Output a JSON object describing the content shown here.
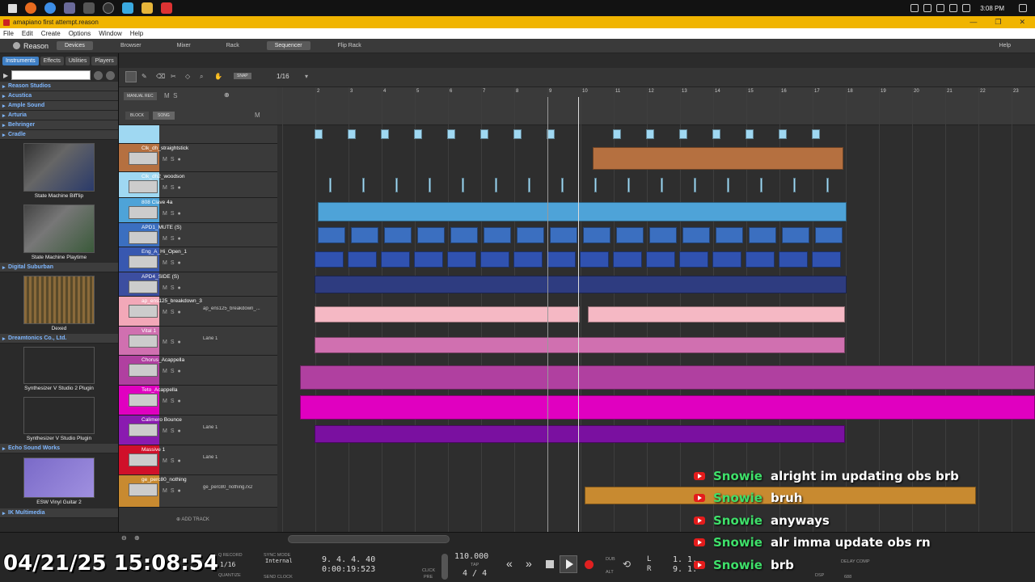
{
  "taskbar": {
    "time": "3:08 PM"
  },
  "window": {
    "title": "amapiano first attempt.reason"
  },
  "menu": [
    "File",
    "Edit",
    "Create",
    "Options",
    "Window",
    "Help"
  ],
  "toolbar": {
    "app": "Reason",
    "tabs": [
      "Devices",
      "Browser",
      "Mixer",
      "Rack",
      "Sequencer",
      "Flip Rack"
    ],
    "help": "Help"
  },
  "browser": {
    "tabs": [
      "Instruments",
      "Effects",
      "Utilities",
      "Players"
    ],
    "categories": [
      "Reason Studios",
      "Acustica",
      "Ample Sound",
      "Arturia",
      "Behringer",
      "Cradle"
    ],
    "patches": [
      {
        "name": "State Machine Biff'lip"
      },
      {
        "name": "State Machine Playtime"
      }
    ],
    "cat2": "Digital Suburban",
    "patch3": "Dexed",
    "cat3": "Dreamtonics Co., Ltd.",
    "patch4": "Synthesizer V Studio 2 Plugin",
    "patch5": "Synthesizer V Studio Plugin",
    "cat4": "Echo Sound Works",
    "patch6": "ESW Vinyl Guitar 2",
    "cat5": "IK Multimedia"
  },
  "seqtools": {
    "snap": "SNAP",
    "quant": "1/16",
    "manual_rec": "MANUAL REC",
    "block": "BLOCK",
    "song": "SONG",
    "add_track": "ADD TRACK"
  },
  "tracks": [
    {
      "name": "Clk_dh_straightstick"
    },
    {
      "name": "Clk_dh2_woodson"
    },
    {
      "name": "808 Clave 4a"
    },
    {
      "name": "APD1_MUTE (S)"
    },
    {
      "name": "Eng_A_Hi_Open_1"
    },
    {
      "name": "APD4_SIDE (S)"
    },
    {
      "name": "ap_ens125_breakdown_3",
      "lane": "ap_ens125_breakdown_..."
    },
    {
      "name": "Vital 1",
      "lane": "Lane 1"
    },
    {
      "name": "Chorus_Acappella"
    },
    {
      "name": "Teto_Acappella"
    },
    {
      "name": "Calimero Bounce",
      "lane": "Lane 1"
    },
    {
      "name": "Massive 1",
      "lane": "Lane 1"
    },
    {
      "name": "ge_perc80_nothing",
      "lane": "ge_perc80_nothing.rx2"
    }
  ],
  "ruler": [
    "2",
    "3",
    "4",
    "5",
    "6",
    "7",
    "8",
    "9",
    "10",
    "11",
    "12",
    "13",
    "14",
    "15",
    "16",
    "17",
    "18",
    "19",
    "20",
    "21",
    "22",
    "23"
  ],
  "chat": [
    {
      "author": "Snowie",
      "text": "alright im updating obs brb"
    },
    {
      "author": "Snowie",
      "text": "bruh"
    },
    {
      "author": "Snowie",
      "text": "anyways"
    },
    {
      "author": "Snowie",
      "text": "alr imma update obs rn"
    },
    {
      "author": "Snowie",
      "text": "brb"
    }
  ],
  "clock": "04/21/25 15:08:54",
  "transport": {
    "q_record": "Q RECORD",
    "quantize": "1/16",
    "quantize_lbl": "QUANTIZE",
    "sync_mode": "SYNC MODE",
    "sync_val": "Internal",
    "send_clock": "SEND CLOCK",
    "position": "9. 4. 4. 40",
    "time": "0:00:19:523",
    "tempo": "110.000",
    "tap": "TAP",
    "signature": "4 / 4",
    "click": "CLICK",
    "pre": "PRE",
    "dub": "DUB",
    "alt": "ALT",
    "L": "L",
    "R": "R",
    "loop_l": "1. 1.",
    "loop_r": "9. 1.",
    "delay_comp": "DELAY COMP",
    "dsp": "DSP",
    "cpu": "688"
  }
}
